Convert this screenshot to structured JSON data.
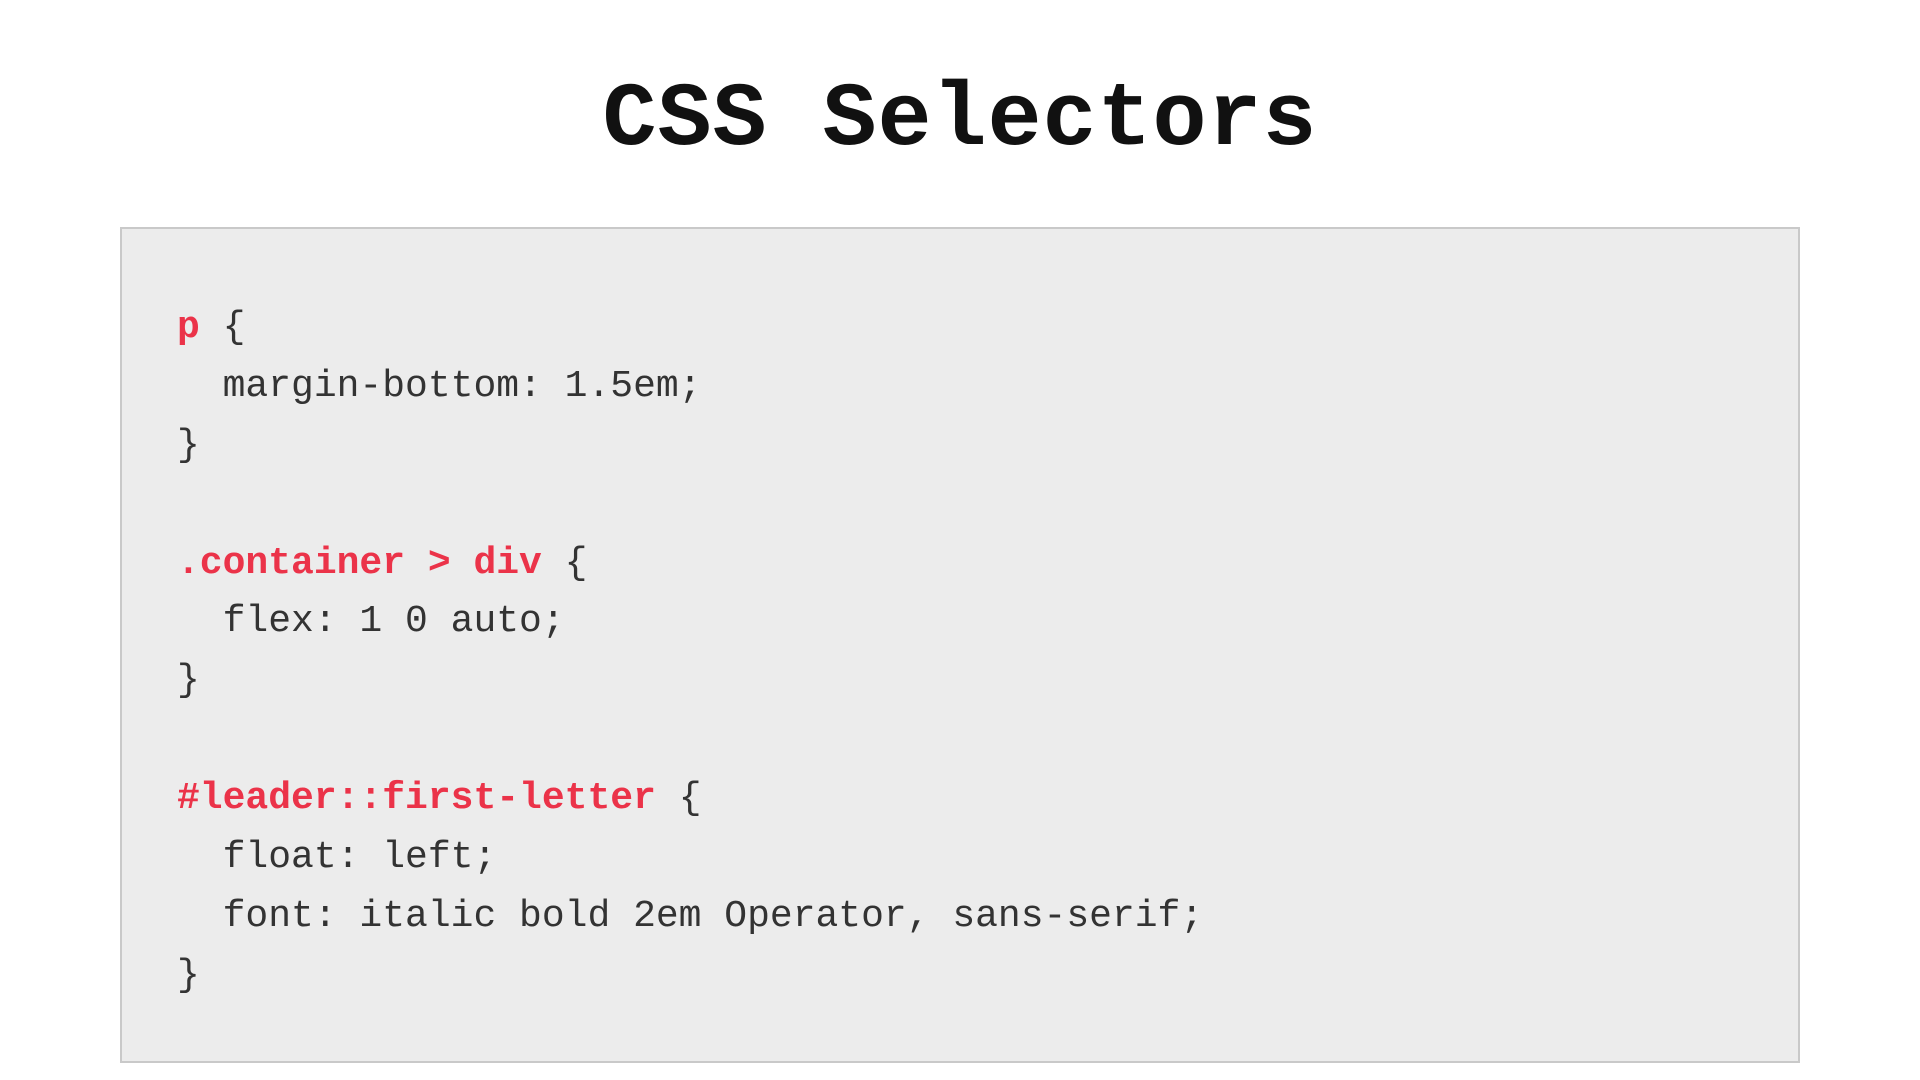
{
  "title": "CSS Selectors",
  "code": {
    "rules": [
      {
        "selector": "p",
        "open": " {",
        "decls": [
          "  margin-bottom: 1.5em;"
        ],
        "close": "}"
      },
      {
        "selector": ".container > div",
        "open": " {",
        "decls": [
          "  flex: 1 0 auto;"
        ],
        "close": "}"
      },
      {
        "selector": "#leader::first-letter",
        "open": " {",
        "decls": [
          "  float: left;",
          "  font: italic bold 2em Operator, sans-serif;"
        ],
        "close": "}"
      }
    ]
  },
  "colors": {
    "selector": "#eb3349",
    "text": "#333333",
    "box_bg": "#ececec",
    "box_border": "#c9c9c9"
  }
}
